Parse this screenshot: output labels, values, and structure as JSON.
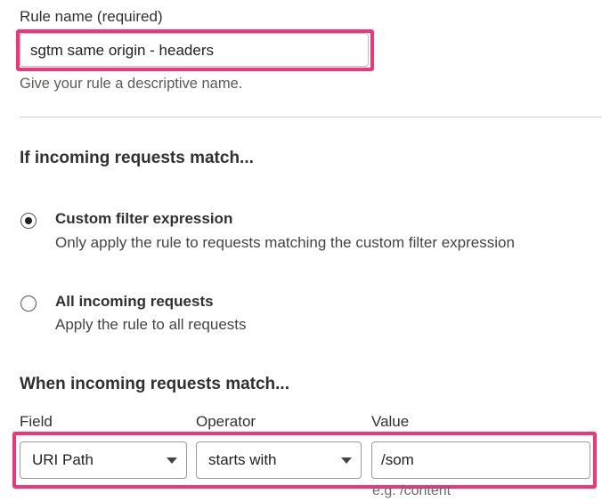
{
  "rule_name": {
    "label": "Rule name (required)",
    "value": "sgtm same origin - headers",
    "help": "Give your rule a descriptive name."
  },
  "incoming": {
    "heading": "If incoming requests match...",
    "options": [
      {
        "title": "Custom filter expression",
        "description": "Only apply the rule to requests matching the custom filter expression",
        "selected": true
      },
      {
        "title": "All incoming requests",
        "description": "Apply the rule to all requests",
        "selected": false
      }
    ]
  },
  "expression": {
    "heading": "When incoming requests match...",
    "field_label": "Field",
    "operator_label": "Operator",
    "value_label": "Value",
    "field_value": "URI Path",
    "operator_value": "starts with",
    "value_value": "/som",
    "value_hint": "e.g. /content"
  },
  "colors": {
    "highlight": "#f0357a"
  }
}
